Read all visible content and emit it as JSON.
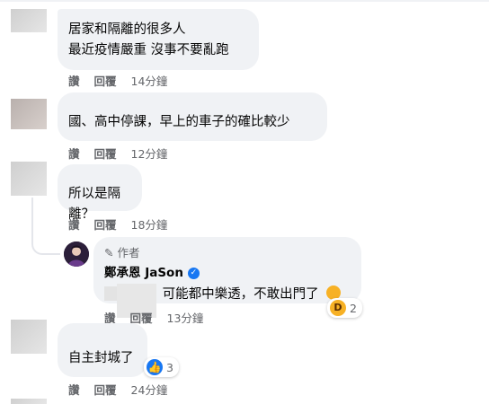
{
  "comments": [
    {
      "text": "居家和隔離的很多人\n最近疫情嚴重 沒事不要亂跑",
      "actions": {
        "like": "讚",
        "reply": "回覆",
        "time": "14分鐘"
      }
    },
    {
      "text": "國、高中停課，早上的車子的確比較少",
      "actions": {
        "like": "讚",
        "reply": "回覆",
        "time": "12分鐘"
      }
    },
    {
      "text": "所以是隔離？",
      "actions": {
        "like": "讚",
        "reply": "回覆",
        "time": "18分鐘"
      }
    },
    {
      "author_tag": "作者",
      "author_name": "鄭承恩 JaSon",
      "text": "可能都中樂透，不敢出門了",
      "reaction": {
        "icon": "haha-icon",
        "count": "2"
      },
      "actions": {
        "like": "讚",
        "reply": "回覆",
        "time": "13分鐘"
      }
    },
    {
      "text": "自主封城了",
      "reaction": {
        "icon": "like-icon",
        "count": "3"
      },
      "actions": {
        "like": "讚",
        "reply": "回覆",
        "time": "24分鐘"
      }
    }
  ],
  "colors": {
    "bubble": "#f0f2f5",
    "meta": "#65676b",
    "like_blue": "#1877f2",
    "haha_yellow": "#f7b125"
  }
}
